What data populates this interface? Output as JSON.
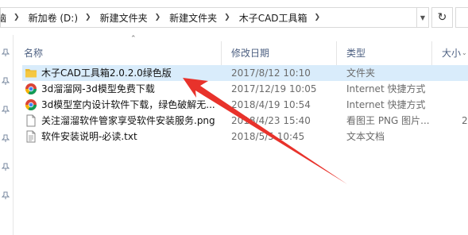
{
  "breadcrumb": {
    "partial": "脑",
    "items": [
      "新加卷 (D:)",
      "新建文件夹",
      "新建文件夹",
      "木子CAD工具箱"
    ]
  },
  "columns": {
    "name": "名称",
    "date": "修改日期",
    "type": "类型",
    "size": "大小"
  },
  "files": [
    {
      "name": "木子CAD工具箱2.0.2.0绿色版",
      "date": "2017/8/12 10:10",
      "type": "文件夹",
      "size": "",
      "icon": "folder-icon",
      "selected": true
    },
    {
      "name": "3d溜溜网-3d模型免费下载",
      "date": "2017/12/19 10:05",
      "type": "Internet 快捷方式",
      "size": "",
      "icon": "chrome-shortcut-icon",
      "selected": false
    },
    {
      "name": "3d模型室内设计软件下载，绿色破解无...",
      "date": "2018/4/19 10:54",
      "type": "Internet 快捷方式",
      "size": "",
      "icon": "chrome-shortcut-icon",
      "selected": false
    },
    {
      "name": "关注溜溜软件管家享受软件安装服务.png",
      "date": "2018/4/23 15:40",
      "type": "看图王 PNG 图片...",
      "size": "2",
      "icon": "png-file-icon",
      "selected": false
    },
    {
      "name": "软件安装说明-必读.txt",
      "date": "2018/5/5 10:45",
      "type": "文本文档",
      "size": "",
      "icon": "txt-file-icon",
      "selected": false
    }
  ],
  "colors": {
    "selected_row": "#d9ecfb",
    "folder": "#f5c842",
    "annotation_arrow": "#e8322b",
    "header_text": "#4d6082"
  }
}
